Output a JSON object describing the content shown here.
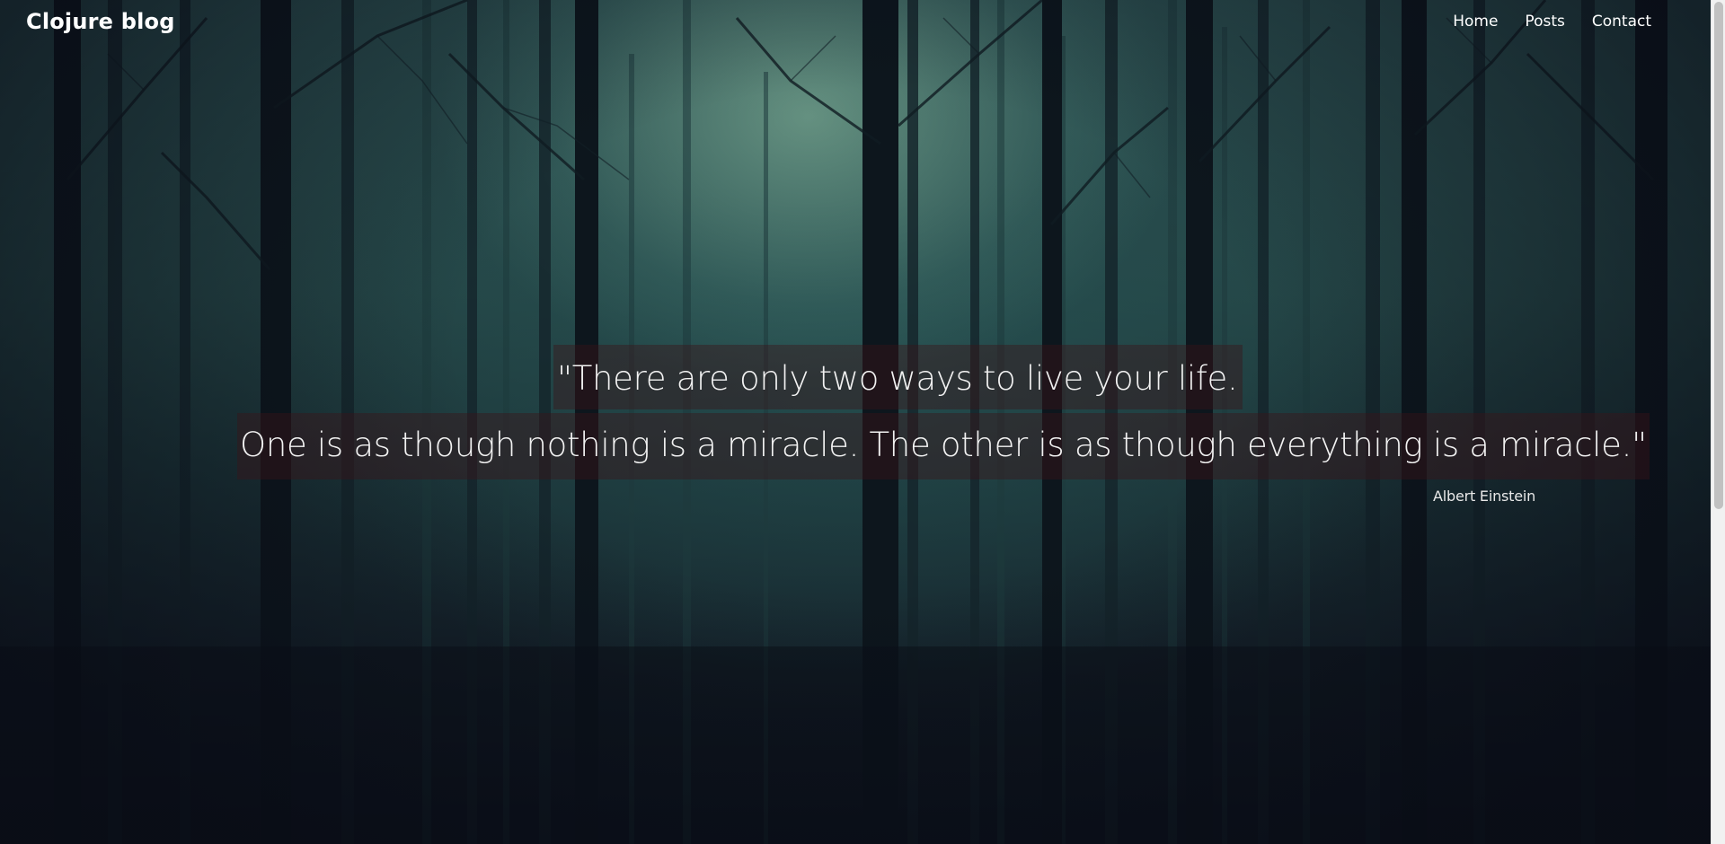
{
  "header": {
    "brand": "Clojure blog",
    "nav": [
      "Home",
      "Posts",
      "Contact"
    ]
  },
  "quote": {
    "line1": "\"There are only two ways to live your life.",
    "line2": "One is as though nothing is a miracle. The other is as though everything is a miracle.\"",
    "author": "Albert Einstein"
  },
  "colors": {
    "text": "#ffffff",
    "quote_highlight": "#3c1419"
  }
}
